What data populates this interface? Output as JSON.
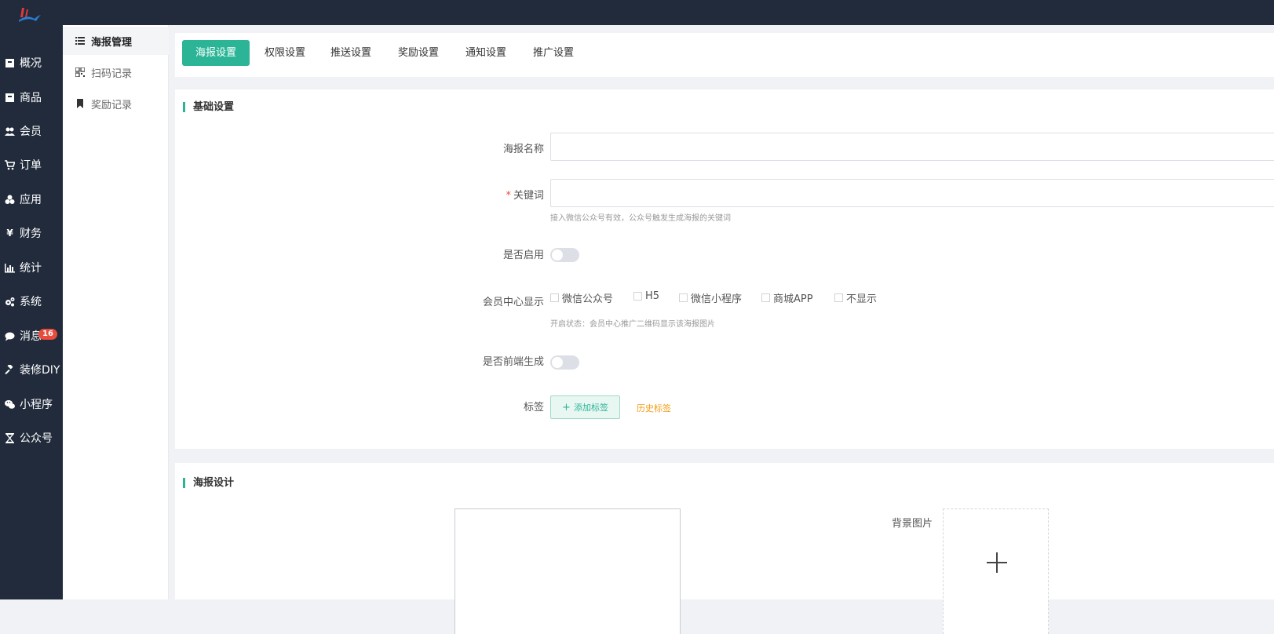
{
  "sidebar": {
    "items": [
      {
        "label": "概况",
        "icon": "overview-icon"
      },
      {
        "label": "商品",
        "icon": "goods-icon"
      },
      {
        "label": "会员",
        "icon": "members-icon"
      },
      {
        "label": "订单",
        "icon": "cart-icon"
      },
      {
        "label": "应用",
        "icon": "apps-icon"
      },
      {
        "label": "财务",
        "icon": "yuan-icon"
      },
      {
        "label": "统计",
        "icon": "chart-icon"
      },
      {
        "label": "系统",
        "icon": "gears-icon"
      },
      {
        "label": "消息",
        "icon": "comment-icon"
      },
      {
        "label": "装修DIY",
        "icon": "gavel-icon"
      },
      {
        "label": "小程序",
        "icon": "wechat-icon"
      },
      {
        "label": "公众号",
        "icon": "hourglass-icon"
      }
    ],
    "message_badge": "16"
  },
  "subnav": {
    "items": [
      {
        "label": "海报管理",
        "icon": "list-icon"
      },
      {
        "label": "扫码记录",
        "icon": "qrcode-icon"
      },
      {
        "label": "奖励记录",
        "icon": "bookmark-icon"
      }
    ]
  },
  "tabs": [
    "海报设置",
    "权限设置",
    "推送设置",
    "奖励设置",
    "通知设置",
    "推广设置"
  ],
  "basic": {
    "title": "基础设置",
    "poster_name_label": "海报名称",
    "poster_name_value": "",
    "keyword_required": "*",
    "keyword_label": "关键词",
    "keyword_value": "",
    "keyword_hint": "接入微信公众号有效，公众号触发生成海报的关键词",
    "enable_label": "是否启用",
    "member_center_label": "会员中心显示",
    "member_center_options": [
      "微信公众号",
      "H5",
      "微信小程序",
      "商城APP",
      "不显示"
    ],
    "member_center_hint": "开启状态：会员中心推广二维码显示该海报图片",
    "frontend_label": "是否前端生成",
    "tags_label": "标签",
    "add_tag": "添加标签",
    "history_tag": "历史标签"
  },
  "design": {
    "title": "海报设计",
    "bg_label": "背景图片"
  },
  "colors": {
    "accent": "#2bb596",
    "sidebar_bg": "#212b3c",
    "badge": "#e84c3d",
    "history_link": "#f39c12"
  }
}
